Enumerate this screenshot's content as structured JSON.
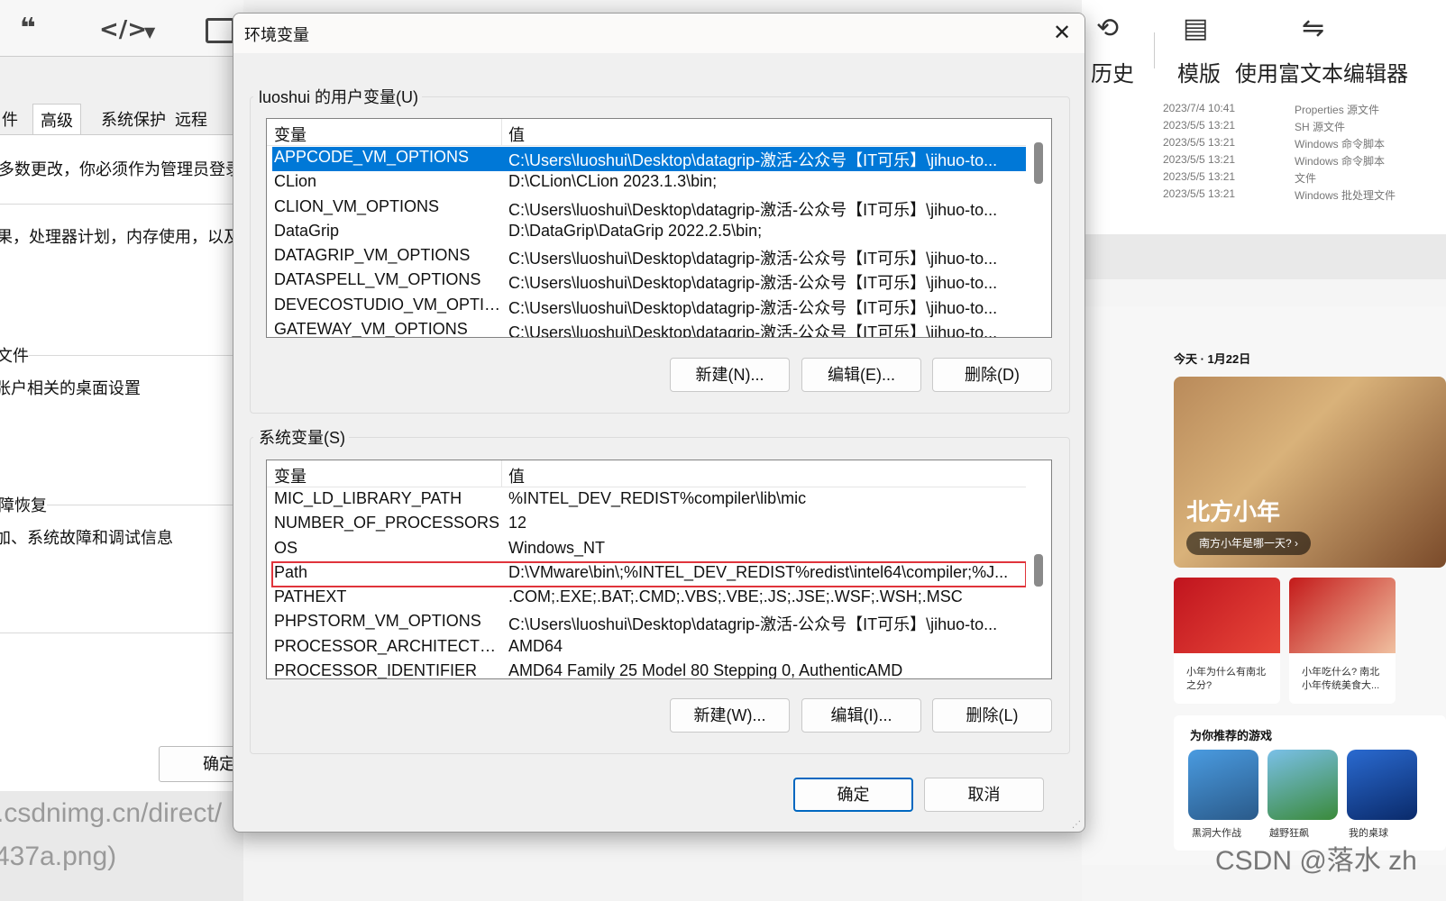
{
  "dialog": {
    "title": "环境变量",
    "user_group_label": "luoshui 的用户变量(U)",
    "system_group_label": "系统变量(S)",
    "col_variable": "变量",
    "col_value": "值",
    "user_vars": [
      {
        "name": "APPCODE_VM_OPTIONS",
        "value": "C:\\Users\\luoshui\\Desktop\\datagrip-激活-公众号【IT可乐】\\jihuo-to..."
      },
      {
        "name": "CLion",
        "value": "D:\\CLion\\CLion 2023.1.3\\bin;"
      },
      {
        "name": "CLION_VM_OPTIONS",
        "value": "C:\\Users\\luoshui\\Desktop\\datagrip-激活-公众号【IT可乐】\\jihuo-to..."
      },
      {
        "name": "DataGrip",
        "value": "D:\\DataGrip\\DataGrip 2022.2.5\\bin;"
      },
      {
        "name": "DATAGRIP_VM_OPTIONS",
        "value": "C:\\Users\\luoshui\\Desktop\\datagrip-激活-公众号【IT可乐】\\jihuo-to..."
      },
      {
        "name": "DATASPELL_VM_OPTIONS",
        "value": "C:\\Users\\luoshui\\Desktop\\datagrip-激活-公众号【IT可乐】\\jihuo-to..."
      },
      {
        "name": "DEVECOSTUDIO_VM_OPTIO...",
        "value": "C:\\Users\\luoshui\\Desktop\\datagrip-激活-公众号【IT可乐】\\jihuo-to..."
      },
      {
        "name": "GATEWAY_VM_OPTIONS",
        "value": "C:\\Users\\luoshui\\Desktop\\datagrip-激活-公众号【IT可乐】\\jihuo-to..."
      }
    ],
    "system_vars": [
      {
        "name": "MIC_LD_LIBRARY_PATH",
        "value": "%INTEL_DEV_REDIST%compiler\\lib\\mic"
      },
      {
        "name": "NUMBER_OF_PROCESSORS",
        "value": "12"
      },
      {
        "name": "OS",
        "value": "Windows_NT"
      },
      {
        "name": "Path",
        "value": "D:\\VMware\\bin\\;%INTEL_DEV_REDIST%redist\\intel64\\compiler;%J..."
      },
      {
        "name": "PATHEXT",
        "value": ".COM;.EXE;.BAT;.CMD;.VBS;.VBE;.JS;.JSE;.WSF;.WSH;.MSC"
      },
      {
        "name": "PHPSTORM_VM_OPTIONS",
        "value": "C:\\Users\\luoshui\\Desktop\\datagrip-激活-公众号【IT可乐】\\jihuo-to..."
      },
      {
        "name": "PROCESSOR_ARCHITECTURE",
        "value": "AMD64"
      },
      {
        "name": "PROCESSOR_IDENTIFIER",
        "value": "AMD64 Family 25 Model 80 Stepping 0, AuthenticAMD"
      }
    ],
    "user_buttons": {
      "new": "新建(N)...",
      "edit": "编辑(E)...",
      "delete": "删除(D)"
    },
    "system_buttons": {
      "new": "新建(W)...",
      "edit": "编辑(I)...",
      "delete": "删除(L)"
    },
    "ok": "确定",
    "cancel": "取消"
  },
  "left_window": {
    "tabs": [
      "件",
      "高级",
      "系统保护",
      "远程"
    ],
    "line1": "多数更改，你必须作为管理员登录",
    "line2": "果，处理器计划，内存使用，以及虚",
    "section2_title": "文件",
    "section2_text": "张户相关的桌面设置",
    "section3_title": "障恢复",
    "section3_text": "加、系统故障和调试信息",
    "ok": "确定",
    "url1": ".csdnimg.cn/direct/",
    "url2": "437a.png)"
  },
  "right_panel": {
    "toolbar": {
      "history": "历史",
      "template": "模版",
      "rich_editor": "使用富文本编辑器"
    },
    "files": [
      {
        "date": "2023/7/4 10:41",
        "type": "Properties 源文件"
      },
      {
        "date": "2023/5/5 13:21",
        "type": "SH 源文件"
      },
      {
        "date": "2023/5/5 13:21",
        "type": "Windows 命令脚本"
      },
      {
        "date": "2023/5/5 13:21",
        "type": "Windows 命令脚本"
      },
      {
        "date": "2023/5/5 13:21",
        "type": "文件"
      },
      {
        "date": "2023/5/5 13:21",
        "type": "Windows 批处理文件"
      }
    ],
    "news_date": "今天 · 1月22日",
    "hero_title": "北方小年",
    "hero_link": "南方小年是哪一天? ›",
    "thumb1": "小年为什么有南北之分?",
    "thumb2": "小年吃什么? 南北小年传统美食大...",
    "games_title": "为你推荐的游戏",
    "games": [
      "黑洞大作战",
      "越野狂飙",
      "我的桌球"
    ],
    "watermark": "CSDN @落水 zh"
  },
  "colors": {
    "selection": "#0078d7",
    "highlight_outline": "#e0343b",
    "default_button_border": "#0067c0"
  }
}
